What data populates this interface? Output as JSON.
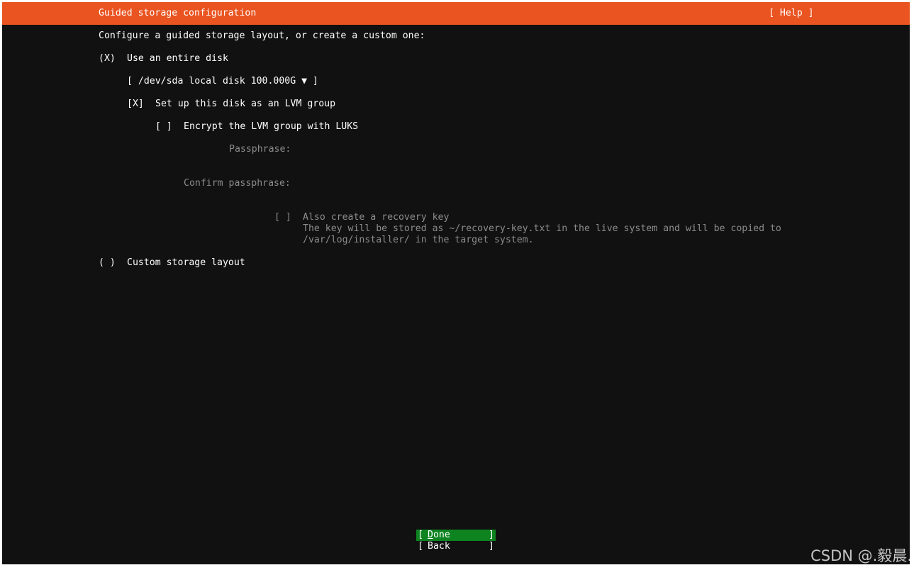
{
  "header": {
    "title": "Guided storage configuration",
    "help_label": "[ Help ]"
  },
  "intro": "Configure a guided storage layout, or create a custom one:",
  "use_entire_disk": {
    "mark": "(X)",
    "label": "Use an entire disk"
  },
  "disk_select": {
    "label": "[ /dev/sda local disk 100.000G ▼ ]"
  },
  "lvm": {
    "mark": "[X]",
    "label": "Set up this disk as an LVM group"
  },
  "encrypt": {
    "mark": "[ ]",
    "label": "Encrypt the LVM group with LUKS"
  },
  "passphrase": {
    "label": "Passphrase:",
    "value": ""
  },
  "confirm_passphrase": {
    "label": "Confirm passphrase:",
    "value": ""
  },
  "recovery": {
    "mark": "[ ]",
    "label": "Also create a recovery key",
    "desc_line1": "The key will be stored as ~/recovery-key.txt in the live system and will be copied to",
    "desc_line2": "/var/log/installer/ in the target system."
  },
  "custom_layout": {
    "mark": "( )",
    "label": "Custom storage layout"
  },
  "buttons": {
    "done": {
      "hotkey": "D",
      "rest": "one"
    },
    "back": {
      "label": "Back"
    }
  },
  "watermark": "CSDN @.毅晨.",
  "colors": {
    "title_bar": "#e95420",
    "background": "#111111",
    "focused_button": "#0e8420",
    "disabled_text": "#8c8c8c"
  }
}
